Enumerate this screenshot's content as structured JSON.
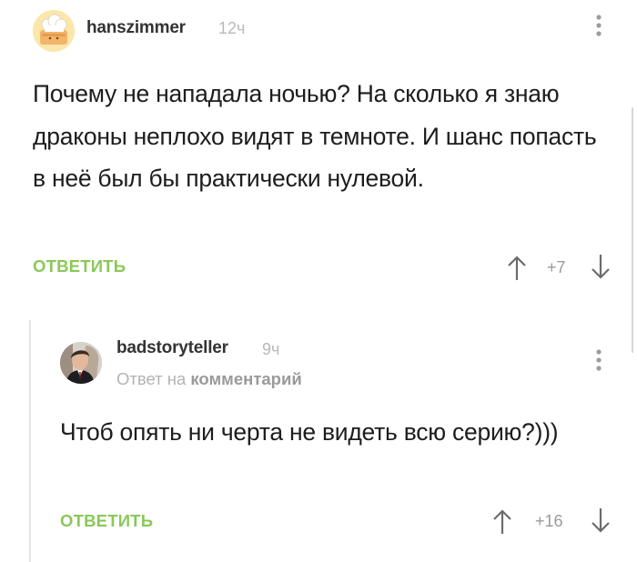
{
  "comments": [
    {
      "author": "hanszimmer",
      "time": "12ч",
      "text": "Почему не нападала ночью? На сколько я знаю драконы неплохо видят в темноте. И шанс попасть в неё был бы практически нулевой.",
      "reply_label": "ОТВЕТИТЬ",
      "score": "+7",
      "avatar_icon": "chef-hat-avatar-icon"
    },
    {
      "author": "badstoryteller",
      "time": "9ч",
      "reply_to_prefix": "Ответ на",
      "reply_to_link": "комментарий",
      "text": "Чтоб опять ни черта не видеть всю серию?)))",
      "reply_label": "ОТВЕТИТЬ",
      "score": "+16",
      "avatar_icon": "person-photo-avatar-icon"
    }
  ],
  "colors": {
    "reply_accent": "#8ac858",
    "text": "#1d1d1d",
    "muted": "#b9b9b9"
  }
}
